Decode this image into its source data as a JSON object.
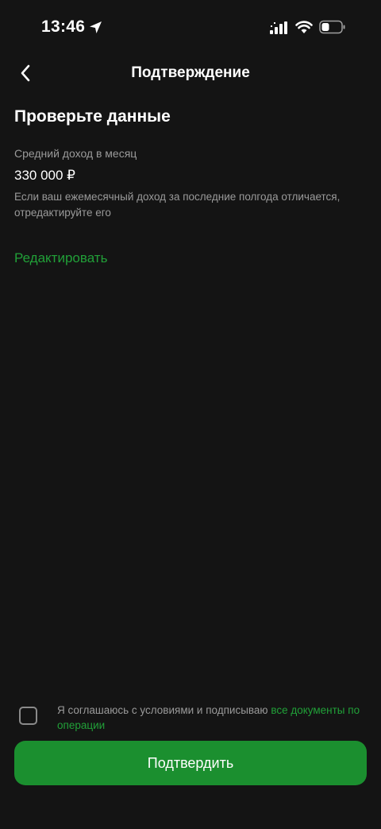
{
  "status_bar": {
    "time": "13:46"
  },
  "nav": {
    "title": "Подтверждение"
  },
  "main": {
    "section_title": "Проверьте данные",
    "income": {
      "label": "Средний доход в месяц",
      "value": "330 000 ₽",
      "hint": "Если ваш ежемесячный доход за последние полгода отличается, отредактируйте его"
    },
    "edit_label": "Редактировать"
  },
  "consent": {
    "checked": false,
    "text": "Я соглашаюсь с условиями и подписываю ",
    "link_text": "все документы по операции"
  },
  "confirm_label": "Подтвердить",
  "colors": {
    "background": "#141414",
    "accent": "#21a038",
    "button": "#1b8f2f",
    "secondary_text": "#9a9a9a"
  },
  "icons": {
    "back": "chevron-left-icon",
    "location": "location-arrow-icon",
    "signal": "cellular-signal-icon",
    "wifi": "wifi-icon",
    "battery": "battery-icon"
  }
}
